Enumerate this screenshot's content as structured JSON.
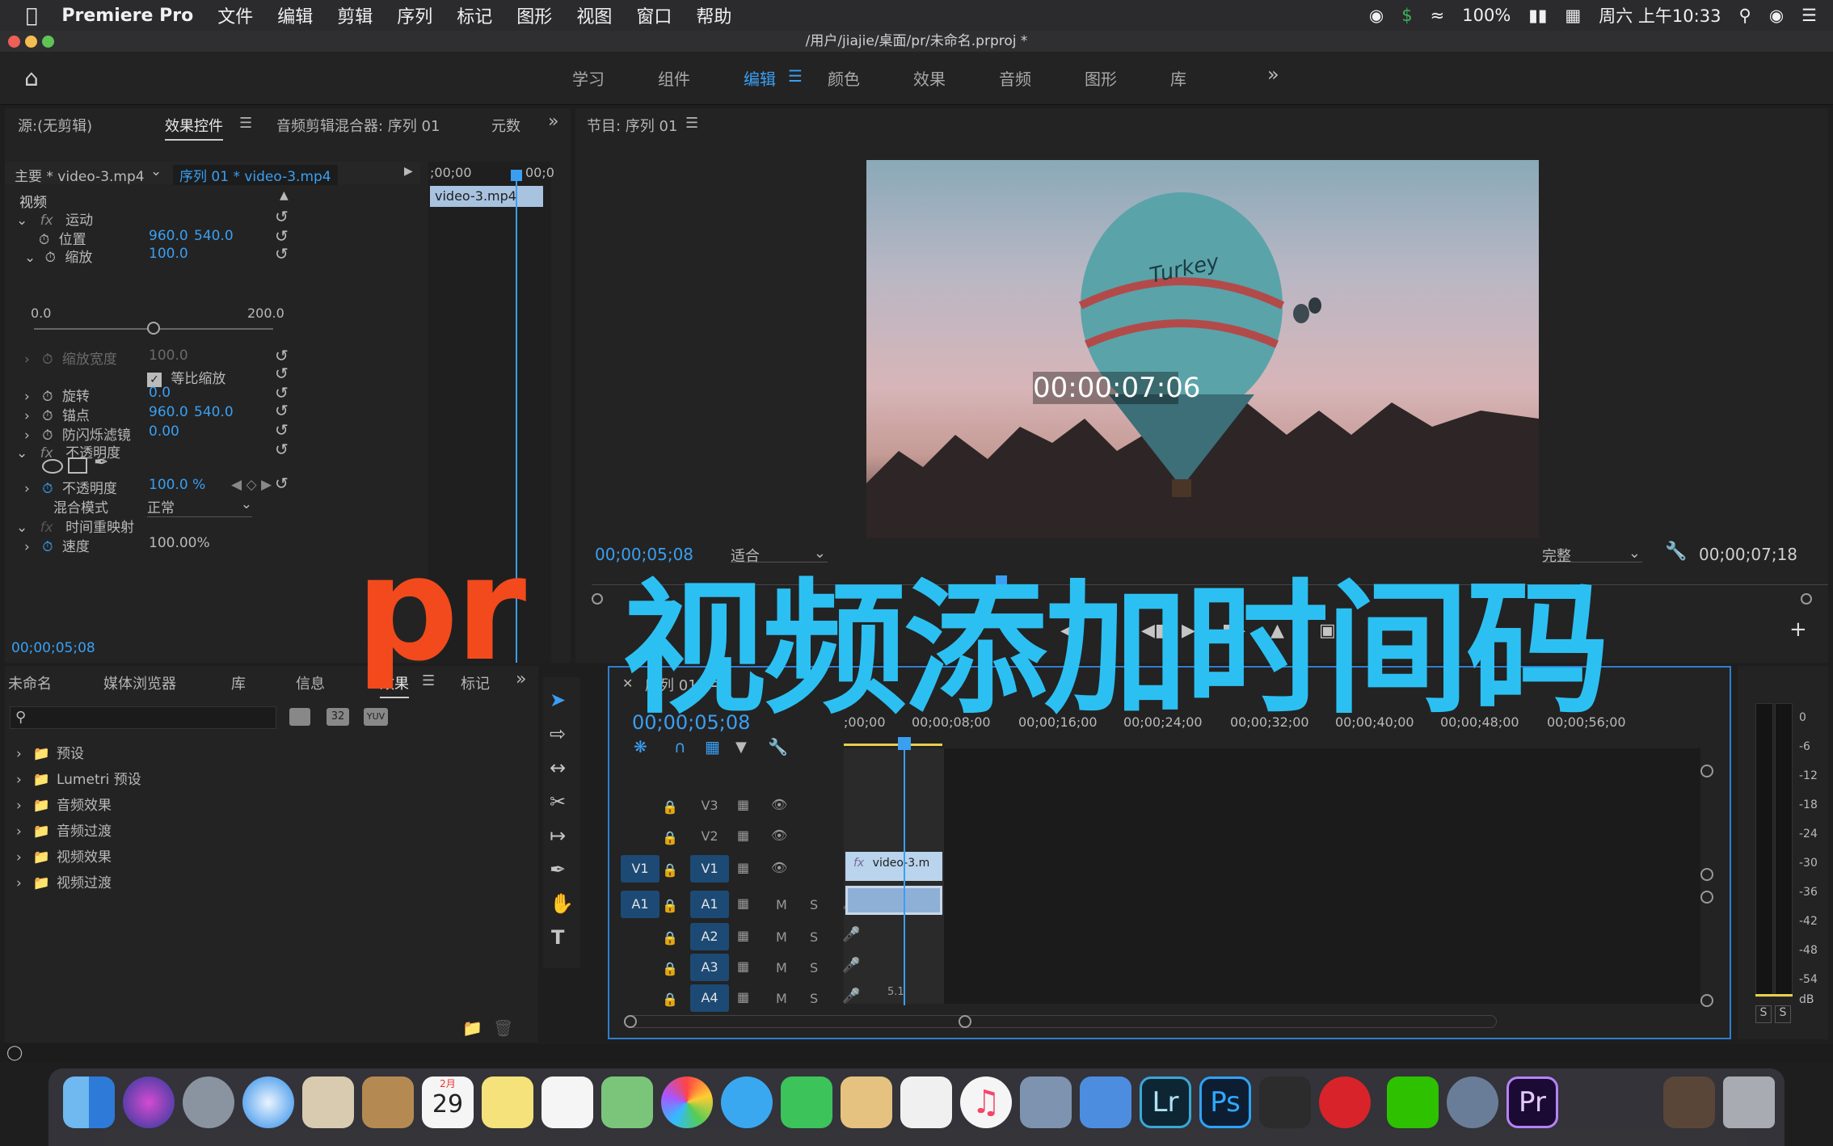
{
  "menubar": {
    "app_name": "Premiere Pro",
    "items": [
      "文件",
      "编辑",
      "剪辑",
      "序列",
      "标记",
      "图形",
      "视图",
      "窗口",
      "帮助"
    ],
    "battery": "100%",
    "datetime": "周六 上午10:33"
  },
  "titlebar": {
    "title": "/用户/jiajie/桌面/pr/未命名.prproj *"
  },
  "workspaces": {
    "tabs": [
      "学习",
      "组件",
      "编辑",
      "颜色",
      "效果",
      "音频",
      "图形",
      "库"
    ],
    "active": "编辑",
    "more": "»"
  },
  "source_panel": {
    "tabs": [
      "源:(无剪辑)",
      "效果控件",
      "音频剪辑混合器: 序列 01",
      "元数"
    ],
    "active_tab": "效果控件",
    "master_clip": "主要 * video-3.mp4",
    "seq_clip": "序列 01 * video-3.mp4",
    "mini_ruler_left": ";00;00",
    "mini_ruler_right": "00;0",
    "mini_clip": "video-3.mp4",
    "section_video": "视频",
    "motion": "运动",
    "position_label": "位置",
    "position_x": "960.0",
    "position_y": "540.0",
    "scale_label": "缩放",
    "scale_value": "100.0",
    "slider_min": "0.0",
    "slider_max": "200.0",
    "scale_width_label": "缩放宽度",
    "scale_width_value": "100.0",
    "uniform_scale": "等比缩放",
    "rotation_label": "旋转",
    "rotation_value": "0.0",
    "anchor_label": "锚点",
    "anchor_x": "960.0",
    "anchor_y": "540.0",
    "flicker_label": "防闪烁滤镜",
    "flicker_value": "0.00",
    "opacity_section": "不透明度",
    "opacity_label": "不透明度",
    "opacity_value": "100.0 %",
    "blend_label": "混合模式",
    "blend_value": "正常",
    "time_remap": "时间重映射",
    "speed_label": "速度",
    "speed_value": "100.00%",
    "timecode": "00;00;05;08"
  },
  "program_monitor": {
    "title": "节目: 序列 01",
    "timecode_overlay": "00:00:07:06",
    "current_tc": "00;00;05;08",
    "fit": "适合",
    "quality": "完整",
    "duration_tc": "00;00;07;18",
    "balloon_text": "Turkey"
  },
  "project_panel": {
    "tabs": [
      "未命名",
      "媒体浏览器",
      "库",
      "信息",
      "效果",
      "标记"
    ],
    "active_tab": "效果",
    "search_placeholder": "",
    "badge_32": "32",
    "badge_yuv": "YUV",
    "folders": [
      "预设",
      "Lumetri 预设",
      "音频效果",
      "音频过渡",
      "视频效果",
      "视频过渡"
    ]
  },
  "timeline": {
    "title": "序列 01",
    "timecode": "00;00;05;08",
    "ruler": [
      ";00;00",
      "00;00;08;00",
      "00;00;16;00",
      "00;00;24;00",
      "00;00;32;00",
      "00;00;40;00",
      "00;00;48;00",
      "00;00;56;00"
    ],
    "video_tracks": [
      "V3",
      "V2",
      "V1"
    ],
    "audio_tracks": [
      "A1",
      "A2",
      "A3",
      "A4"
    ],
    "src_v1": "V1",
    "src_a1": "A1",
    "mute": "M",
    "solo": "S",
    "clip_name": "video-3.m",
    "a4_extra": "5.1"
  },
  "meter": {
    "scale": [
      "0",
      "-6",
      "-12",
      "-18",
      "-24",
      "-30",
      "-36",
      "-42",
      "-48",
      "-54",
      "dB"
    ],
    "solo_l": "S",
    "solo_r": "S"
  },
  "overlay": {
    "pr": "pr",
    "title": "视频添加时间码"
  },
  "dock": {
    "calendar_month": "2月",
    "calendar_day": "29",
    "lr": "Lr",
    "ps": "Ps",
    "pr": "Pr"
  },
  "colors": {
    "accent": "#3a9ff2",
    "overlay_red": "#f24a1c",
    "overlay_cyan": "#2cc0f2"
  }
}
